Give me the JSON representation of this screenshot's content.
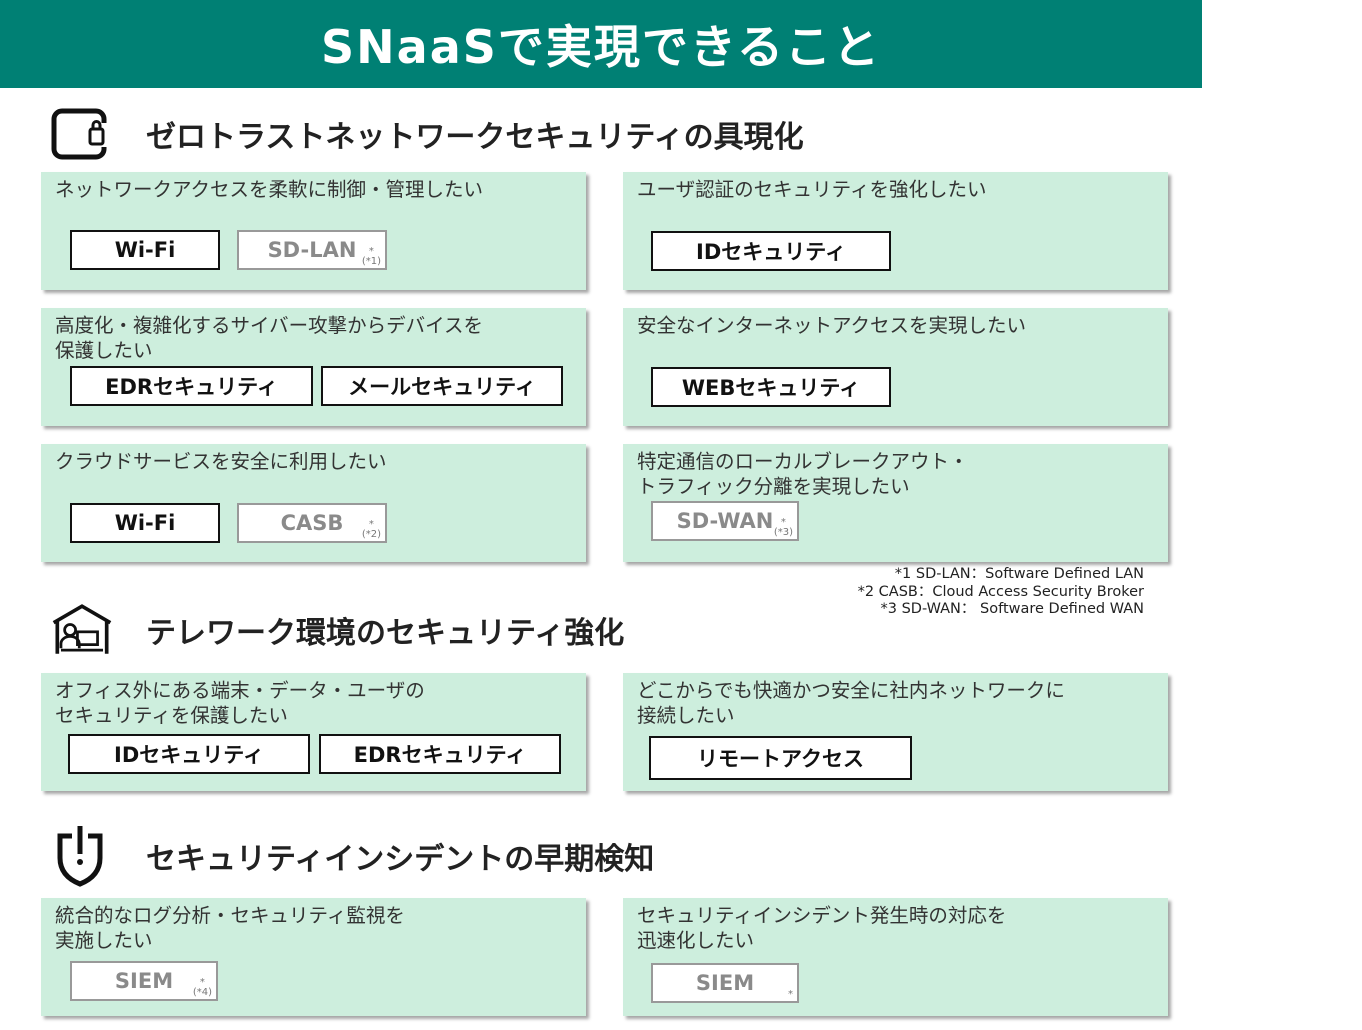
{
  "title": "SNaaSで実現できること",
  "sections": [
    {
      "icon": "mobile-lock-icon",
      "title": "ゼロトラストネットワークセキュリティの具現化"
    },
    {
      "icon": "home-office-icon",
      "title": "テレワーク環境のセキュリティ強化"
    },
    {
      "icon": "shield-alert-icon",
      "title": "セキュリティインシデントの早期検知"
    }
  ],
  "cards": [
    {
      "text": "ネットワークアクセスを柔軟に制御・管理したい",
      "tags": [
        {
          "label": "Wi-Fi",
          "state": "active"
        },
        {
          "label": "SD-LAN",
          "state": "inactive",
          "note": "*\n(*1)"
        }
      ]
    },
    {
      "text": "ユーザ認証のセキュリティを強化したい",
      "tags": [
        {
          "label": "IDセキュリティ",
          "state": "active"
        }
      ]
    },
    {
      "text": "高度化・複雑化するサイバー攻撃からデバイスを\n保護したい",
      "tags": [
        {
          "label": "EDRセキュリティ",
          "state": "active"
        },
        {
          "label": "メールセキュリティ",
          "state": "active"
        }
      ]
    },
    {
      "text": "安全なインターネットアクセスを実現したい",
      "tags": [
        {
          "label": "WEBセキュリティ",
          "state": "active"
        }
      ]
    },
    {
      "text": "クラウドサービスを安全に利用したい",
      "tags": [
        {
          "label": "Wi-Fi",
          "state": "active"
        },
        {
          "label": "CASB",
          "state": "inactive",
          "note": "*\n(*2)"
        }
      ]
    },
    {
      "text": "特定通信のローカルブレークアウト・\nトラフィック分離を実現したい",
      "tags": [
        {
          "label": "SD-WAN",
          "state": "inactive",
          "note": "*\n(*3)"
        }
      ]
    },
    {
      "text": "オフィス外にある端末・データ・ユーザの\nセキュリティを保護したい",
      "tags": [
        {
          "label": "IDセキュリティ",
          "state": "active"
        },
        {
          "label": "EDRセキュリティ",
          "state": "active"
        }
      ]
    },
    {
      "text": "どこからでも快適かつ安全に社内ネットワークに\n接続したい",
      "tags": [
        {
          "label": "リモートアクセス",
          "state": "active"
        }
      ]
    },
    {
      "text": "統合的なログ分析・セキュリティ監視を\n実施したい",
      "tags": [
        {
          "label": "SIEM",
          "state": "inactive",
          "note": "*\n(*4)"
        }
      ]
    },
    {
      "text": "セキュリティインシデント発生時の対応を\n迅速化したい",
      "tags": [
        {
          "label": "SIEM",
          "state": "inactive",
          "note": "*"
        }
      ]
    }
  ],
  "footnotes": [
    "*1 SD-LAN：Software Defined LAN",
    "*2 CASB：Cloud Access Security Broker",
    "*3 SD-WAN： Software Defined WAN"
  ],
  "colors": {
    "banner": "#008074",
    "card": "#cdeedd",
    "tag_border_active": "#111111",
    "tag_border_inactive": "#999999"
  }
}
